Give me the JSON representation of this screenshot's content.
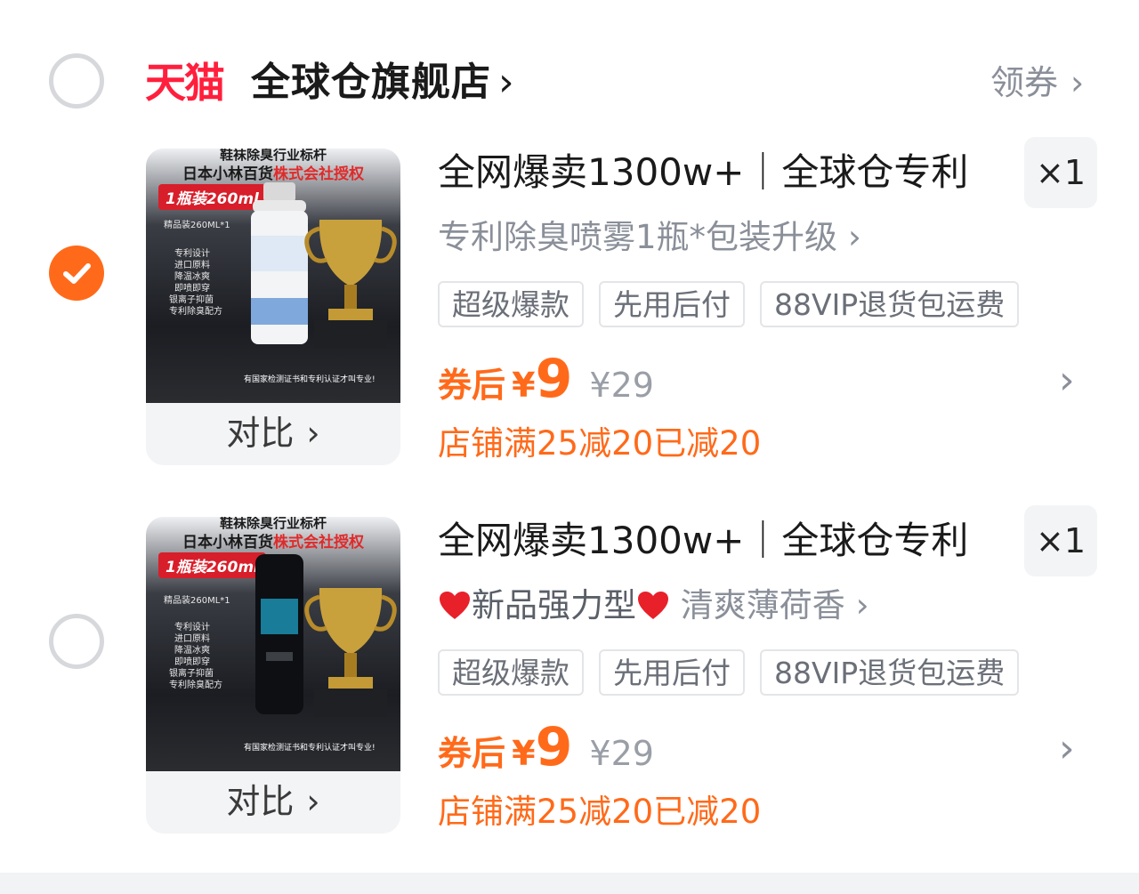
{
  "shop": {
    "logo_text": "天猫",
    "name": "全球仓旗舰店",
    "name_chevron": "›",
    "coupon_label": "领券",
    "coupon_chevron": "›",
    "brand_color": "#ff1f3d",
    "accent_color": "#ff6a1a"
  },
  "products": [
    {
      "selected": true,
      "image_overlay": {
        "line1": "鞋袜除臭行业标杆",
        "line2_prefix": "日本小林百货",
        "line2_highlight": "株式会社授权",
        "badge": "1瓶装260ml",
        "small": [
          "精品装260ML*1",
          "专利设计",
          "进口原料",
          "降温冰爽",
          "即喷即穿",
          "银离子抑菌",
          "专利除臭配方"
        ],
        "bottom": "有国家检测证书和专利认证才叫专业!"
      },
      "compare_label": "对比",
      "compare_chevron": "›",
      "title": "全网爆卖1300w+｜全球仓专利",
      "spec": "专利除臭喷雾1瓶*包装升级",
      "spec_chevron": "›",
      "quantity": "×1",
      "tags": [
        "超级爆款",
        "先用后付",
        "88VIP退货包运费"
      ],
      "price_label": "券后",
      "price_currency": "¥",
      "price_value": "9",
      "original_price": "¥29",
      "promo": "店铺满25减20已减20",
      "row_chevron": "›"
    },
    {
      "selected": false,
      "image_overlay": {
        "line1": "鞋袜除臭行业标杆",
        "line2_prefix": "日本小林百货",
        "line2_highlight": "株式会社授权",
        "badge": "1瓶装260ml",
        "small": [
          "精品装260ML*1",
          "专利设计",
          "进口原料",
          "降温冰爽",
          "即喷即穿",
          "银离子抑菌",
          "专利除臭配方"
        ],
        "bottom": "有国家检测证书和专利认证才叫专业!"
      },
      "compare_label": "对比",
      "compare_chevron": "›",
      "title": "全网爆卖1300w+｜全球仓专利",
      "spec_prefix_icon": "heart-icon",
      "spec_text1": "新品强力型",
      "spec_text2": " 清爽薄荷香",
      "spec_chevron": "›",
      "quantity": "×1",
      "tags": [
        "超级爆款",
        "先用后付",
        "88VIP退货包运费"
      ],
      "price_label": "券后",
      "price_currency": "¥",
      "price_value": "9",
      "original_price": "¥29",
      "promo": "店铺满25减20已减20",
      "row_chevron": "›"
    }
  ]
}
